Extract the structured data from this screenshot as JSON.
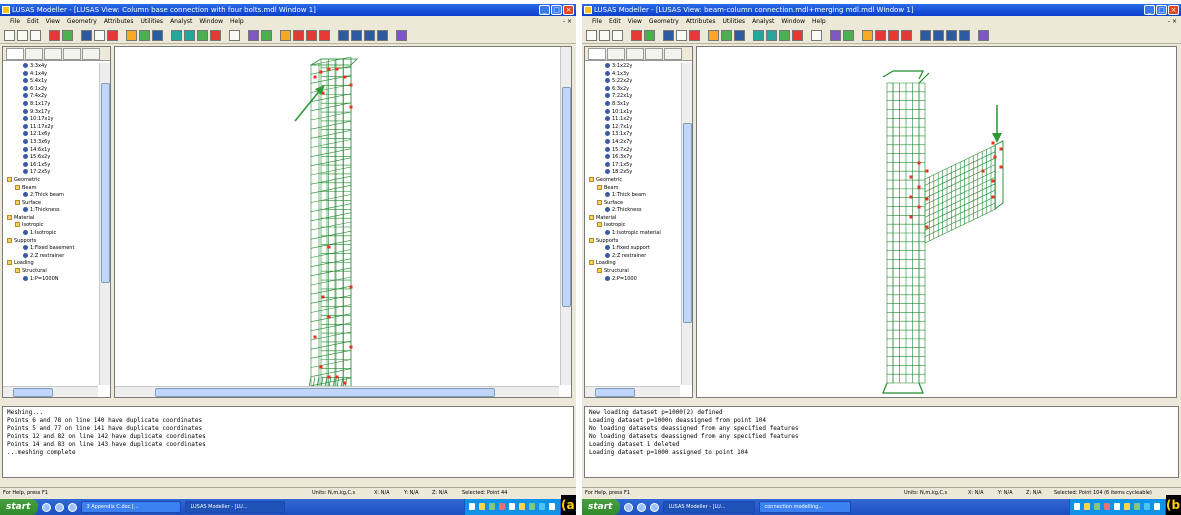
{
  "panel_a": {
    "title": "LUSAS Modeller - [LUSAS View: Column base connection with four bolts.mdl Window 1]",
    "menu_items": [
      "File",
      "Edit",
      "View",
      "Geometry",
      "Attributes",
      "Utilities",
      "Analyst",
      "Window",
      "Help"
    ],
    "menu_right": "- ×",
    "tree_items": [
      {
        "label": "3:3x4y",
        "kind": "load",
        "indent": 2
      },
      {
        "label": "4:1x4y",
        "kind": "load",
        "indent": 2
      },
      {
        "label": "5:4x1y",
        "kind": "load",
        "indent": 2
      },
      {
        "label": "6:1x2y",
        "kind": "load",
        "indent": 2
      },
      {
        "label": "7:4x2y",
        "kind": "load",
        "indent": 2
      },
      {
        "label": "8:1x17y",
        "kind": "load",
        "indent": 2
      },
      {
        "label": "9:3x17y",
        "kind": "load",
        "indent": 2
      },
      {
        "label": "10:17x1y",
        "kind": "load",
        "indent": 2
      },
      {
        "label": "11:17x2y",
        "kind": "load",
        "indent": 2
      },
      {
        "label": "12:1x6y",
        "kind": "load",
        "indent": 2
      },
      {
        "label": "13:3x6y",
        "kind": "load",
        "indent": 2
      },
      {
        "label": "14:6x1y",
        "kind": "load",
        "indent": 2
      },
      {
        "label": "15:6x2y",
        "kind": "load",
        "indent": 2
      },
      {
        "label": "16:1x5y",
        "kind": "load",
        "indent": 2
      },
      {
        "label": "17:2x5y",
        "kind": "load",
        "indent": 2
      },
      {
        "label": "Geometric",
        "kind": "fold",
        "indent": 0
      },
      {
        "label": "Beam",
        "kind": "fold",
        "indent": 1
      },
      {
        "label": "2:Thick beam",
        "kind": "load",
        "indent": 2
      },
      {
        "label": "Surface",
        "kind": "fold",
        "indent": 1
      },
      {
        "label": "1:Thickness",
        "kind": "load",
        "indent": 2
      },
      {
        "label": "Material",
        "kind": "fold",
        "indent": 0
      },
      {
        "label": "Isotropic",
        "kind": "fold",
        "indent": 1
      },
      {
        "label": "1:Isotropic",
        "kind": "load",
        "indent": 2
      },
      {
        "label": "Supports",
        "kind": "fold",
        "indent": 0
      },
      {
        "label": "1:Fixed basement",
        "kind": "load",
        "indent": 2
      },
      {
        "label": "2:Z restrainer",
        "kind": "load",
        "indent": 2
      },
      {
        "label": "Loading",
        "kind": "fold",
        "indent": 0
      },
      {
        "label": "Structural",
        "kind": "fold",
        "indent": 1
      },
      {
        "label": "1:P=1000N",
        "kind": "load",
        "indent": 2
      }
    ],
    "console_lines": [
      "Meshing...",
      "Points 6 and 78 on line 140 have duplicate coordinates",
      "Points 5 and 77 on line 141 have duplicate coordinates",
      "Points 12 and 82 on line 142 have duplicate coordinates",
      "Points 14 and 83 on line 143 have duplicate coordinates",
      "...meshing complete"
    ],
    "status_help": "For Help, press F1",
    "status_units": "Units: N,m,kg,C,s",
    "status_x": "X: N/A",
    "status_y": "Y: N/A",
    "status_z": "Z: N/A",
    "status_selected": "Selected: Point 44",
    "taskbar_start": "start",
    "taskbar_tasks": [
      "3 Appendix C.doc [...",
      "LUSAS Modeller - [LU..."
    ],
    "label": "(a)"
  },
  "panel_b": {
    "title": "LUSAS Modeller - [LUSAS View: beam-column connection.mdl+merging mdl.mdl Window 1]",
    "menu_items": [
      "File",
      "Edit",
      "View",
      "Geometry",
      "Attributes",
      "Utilities",
      "Analyst",
      "Window",
      "Help"
    ],
    "menu_right": "- ×",
    "tree_items": [
      {
        "label": "3:1x22y",
        "kind": "load",
        "indent": 2
      },
      {
        "label": "4:1x3y",
        "kind": "load",
        "indent": 2
      },
      {
        "label": "5:22x2y",
        "kind": "load",
        "indent": 2
      },
      {
        "label": "6:3x2y",
        "kind": "load",
        "indent": 2
      },
      {
        "label": "7:22x1y",
        "kind": "load",
        "indent": 2
      },
      {
        "label": "8:3x1y",
        "kind": "load",
        "indent": 2
      },
      {
        "label": "10:1x1y",
        "kind": "load",
        "indent": 2
      },
      {
        "label": "11:1x2y",
        "kind": "load",
        "indent": 2
      },
      {
        "label": "12:7x1y",
        "kind": "load",
        "indent": 2
      },
      {
        "label": "13:1x7y",
        "kind": "load",
        "indent": 2
      },
      {
        "label": "14:2x7y",
        "kind": "load",
        "indent": 2
      },
      {
        "label": "15:7x2y",
        "kind": "load",
        "indent": 2
      },
      {
        "label": "16:3x7y",
        "kind": "load",
        "indent": 2
      },
      {
        "label": "17:1x5y",
        "kind": "load",
        "indent": 2
      },
      {
        "label": "18:2x5y",
        "kind": "load",
        "indent": 2
      },
      {
        "label": "Geometric",
        "kind": "fold",
        "indent": 0
      },
      {
        "label": "Beam",
        "kind": "fold",
        "indent": 1
      },
      {
        "label": "1:Thick beam",
        "kind": "load",
        "indent": 2
      },
      {
        "label": "Surface",
        "kind": "fold",
        "indent": 1
      },
      {
        "label": "2:Thickness",
        "kind": "load",
        "indent": 2
      },
      {
        "label": "Material",
        "kind": "fold",
        "indent": 0
      },
      {
        "label": "Isotropic",
        "kind": "fold",
        "indent": 1
      },
      {
        "label": "1:Isotropic material",
        "kind": "load",
        "indent": 2
      },
      {
        "label": "Supports",
        "kind": "fold",
        "indent": 0
      },
      {
        "label": "1:fixed support",
        "kind": "load",
        "indent": 2
      },
      {
        "label": "2:Z restrainer",
        "kind": "load",
        "indent": 2
      },
      {
        "label": "Loading",
        "kind": "fold",
        "indent": 0
      },
      {
        "label": "Structural",
        "kind": "fold",
        "indent": 1
      },
      {
        "label": "2:P=1000",
        "kind": "load",
        "indent": 2
      }
    ],
    "console_lines": [
      "New loading dataset p=1000(2) defined",
      "Loading dataset p=1000n deassigned from point 104",
      "No loading datasets deassigned from any specified features",
      "No loading datasets deassigned from any specified features",
      "Loading dataset 1 deleted",
      "Loading dataset p=1000 assigned to point 104"
    ],
    "status_help": "For Help, press F1",
    "status_units": "Units: N,m,kg,C,s",
    "status_x": "X: N/A",
    "status_y": "Y: N/A",
    "status_z": "Z: N/A",
    "status_selected": "Selected: Point 104 (6 items cycleable)",
    "taskbar_start": "start",
    "taskbar_tasks": [
      "LUSAS Modeller - [LU...",
      "connection modelling..."
    ],
    "label": "(b)"
  },
  "colors": {
    "mesh": "#1f8a2e",
    "selected_node": "#e8311e",
    "load_arrow": "#2e9a3c",
    "titlebar": "#0a3fcc",
    "taskbar": "#245edb",
    "start_button": "#3c9a35"
  },
  "icons": {
    "tree_load": "loadcase-icon",
    "tree_folder": "folder-icon",
    "window_controls": [
      "minimize-icon",
      "maximize-icon",
      "close-icon"
    ]
  }
}
